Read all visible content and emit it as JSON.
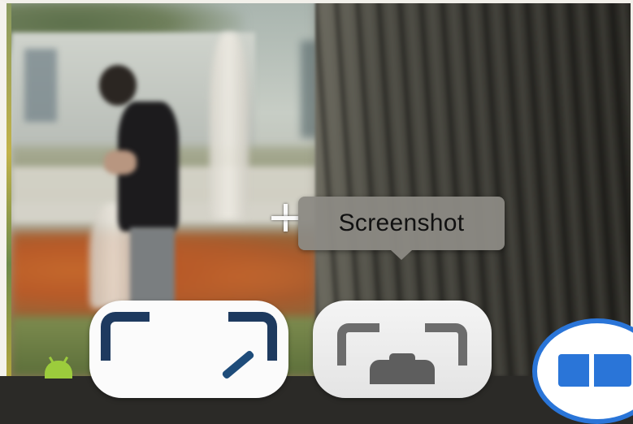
{
  "tooltip": {
    "text": "Screenshot"
  },
  "cursor": {
    "icon": "crosshair-plus-icon"
  },
  "dock": {
    "items": [
      {
        "icon": "screen-annotate-app-icon"
      },
      {
        "icon": "screenshot-app-icon"
      },
      {
        "icon": "blue-window-app-icon"
      },
      {
        "icon": "android-icon"
      }
    ]
  },
  "colors": {
    "tooltip_bg": "#8c8a84",
    "annotate_blue": "#1e3a5f",
    "screenshot_gray": "#6c6c6c",
    "app_blue": "#2a75d8",
    "android_green": "#9ccc3c"
  }
}
